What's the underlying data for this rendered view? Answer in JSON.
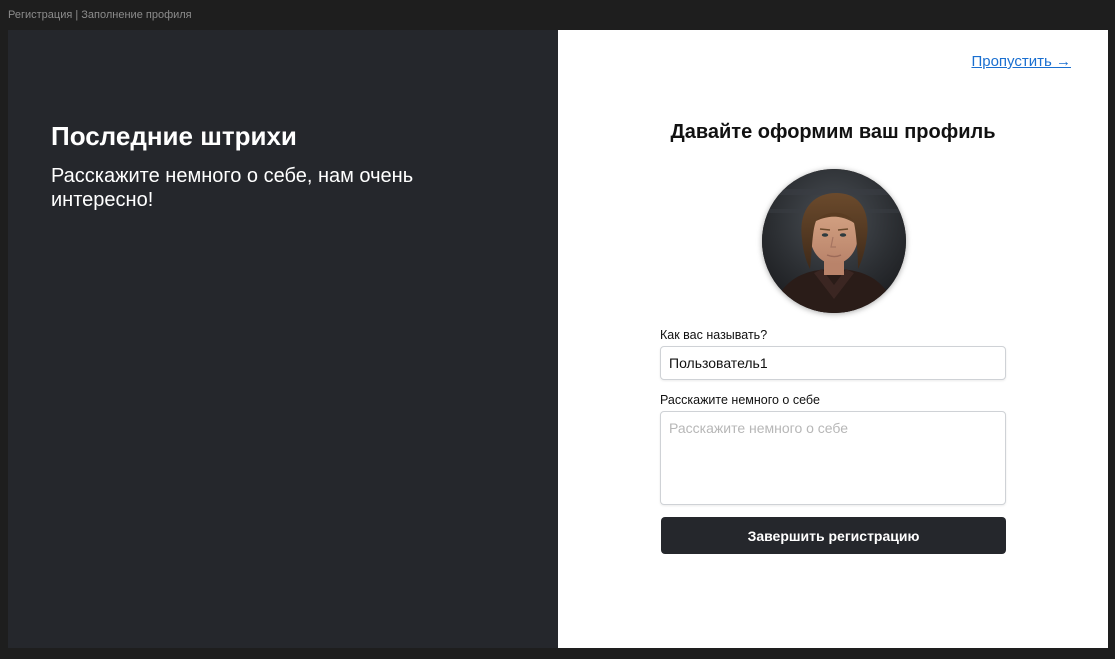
{
  "window": {
    "title": "Регистрация | Заполнение профиля"
  },
  "left_panel": {
    "title": "Последние штрихи",
    "subtitle": "Расскажите немного о себе, нам очень интересно!"
  },
  "right_panel": {
    "skip_link": "Пропустить →",
    "title": "Давайте оформим ваш профиль",
    "avatar": "profile-photo",
    "name_field": {
      "label": "Как вас называть?",
      "value": "Пользователь1"
    },
    "about_field": {
      "label": "Расскажите немного о себе",
      "placeholder": "Расскажите немного о себе",
      "value": ""
    },
    "submit_label": "Завершить регистрацию"
  },
  "colors": {
    "dark_panel": "#25272c",
    "link": "#1a6fd0",
    "button": "#25272c"
  }
}
